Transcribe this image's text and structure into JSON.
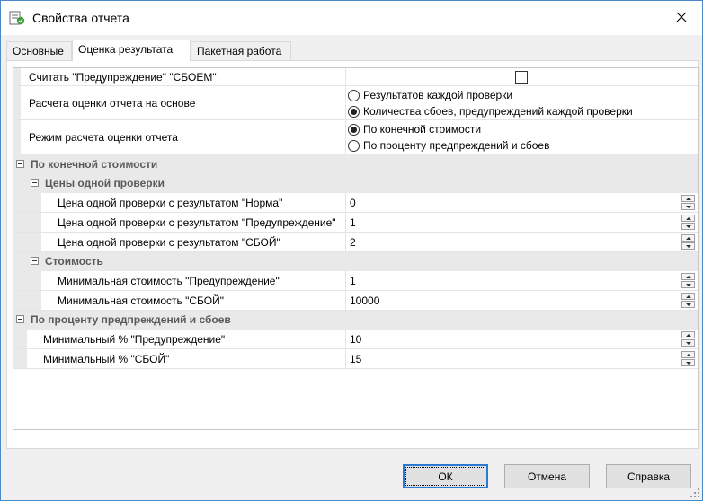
{
  "window": {
    "title": "Свойства отчета",
    "close_glyph": "✕"
  },
  "tabs": [
    {
      "label": "Основные"
    },
    {
      "label": "Оценка результата"
    },
    {
      "label": "Пакетная работа"
    }
  ],
  "props": {
    "count_warning_as_fail": {
      "label": "Считать \"Предупреждение\" \"СБОЕМ\"",
      "checked": false
    },
    "basis": {
      "label": "Расчета оценки отчета на основе",
      "options": [
        "Результатов каждой проверки",
        "Количества сбоев, предупреждений каждой проверки"
      ],
      "selected": 1
    },
    "mode": {
      "label": "Режим расчета оценки отчета",
      "options": [
        "По конечной стоимости",
        "По проценту предпреждений и сбоев"
      ],
      "selected": 0
    }
  },
  "cat_final_cost": {
    "label": "По конечной стоимости"
  },
  "sub_check_prices": {
    "label": "Цены одной проверки",
    "rows": [
      {
        "label": "Цена одной проверки с результатом \"Норма\"",
        "value": "0"
      },
      {
        "label": "Цена одной проверки с результатом \"Предупреждение\"",
        "value": "1"
      },
      {
        "label": "Цена одной проверки с результатом \"СБОЙ\"",
        "value": "2"
      }
    ]
  },
  "sub_cost": {
    "label": "Стоимость",
    "rows": [
      {
        "label": "Минимальная стоимость \"Предупреждение\"",
        "value": "1"
      },
      {
        "label": "Минимальная стоимость \"СБОЙ\"",
        "value": "10000"
      }
    ]
  },
  "cat_percent": {
    "label": "По проценту предпреждений и сбоев",
    "rows": [
      {
        "label": "Минимальный % \"Предупреждение\"",
        "value": "10"
      },
      {
        "label": "Минимальный % \"СБОЙ\"",
        "value": "15"
      }
    ]
  },
  "buttons": {
    "ok": "ОК",
    "cancel": "Отмена",
    "help": "Справка"
  },
  "icons": {
    "app": "report-properties-icon",
    "close": "close-icon"
  }
}
